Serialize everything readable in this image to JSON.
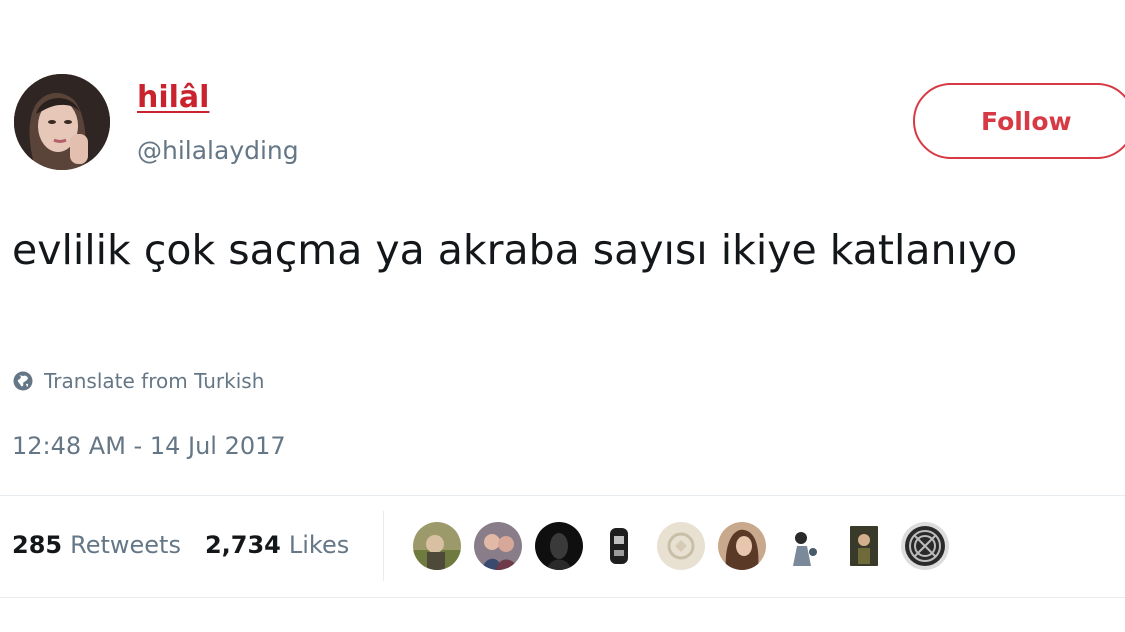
{
  "user": {
    "display_name": "hilâl",
    "handle": "@hilalayding"
  },
  "follow_button": {
    "label": "Follow",
    "accent_color": "#d73a44"
  },
  "tweet": {
    "text": "evlilik çok saçma ya akraba sayısı ikiye katlanıyo",
    "translate_label": "Translate from Turkish",
    "translate_icon": "globe-icon",
    "timestamp": "12:48 AM - 14 Jul 2017"
  },
  "stats": {
    "retweets_count": "285",
    "retweets_label": "Retweets",
    "likes_count": "2,734",
    "likes_label": "Likes"
  },
  "likers": [
    {
      "icon": "liker-avatar-icon"
    },
    {
      "icon": "liker-avatar-icon"
    },
    {
      "icon": "liker-avatar-icon"
    },
    {
      "icon": "liker-avatar-icon"
    },
    {
      "icon": "liker-avatar-icon"
    },
    {
      "icon": "liker-avatar-icon"
    },
    {
      "icon": "liker-avatar-icon"
    },
    {
      "icon": "liker-avatar-icon"
    },
    {
      "icon": "liker-avatar-icon"
    }
  ],
  "colors": {
    "name_color": "#c9232f",
    "secondary_text": "#657786",
    "primary_text": "#14171a"
  }
}
